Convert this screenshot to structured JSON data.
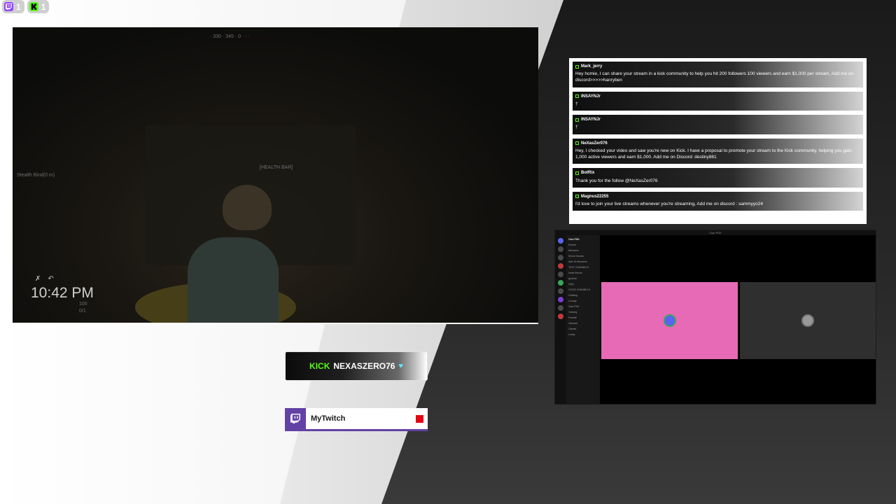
{
  "badges": [
    {
      "platform": "twitch",
      "icon": "twitch-icon",
      "count": "1",
      "color": "#9146ff"
    },
    {
      "platform": "kick",
      "icon": "kick-icon",
      "count": "1",
      "color": "#53fc18"
    }
  ],
  "game": {
    "clock": "10:42 PM",
    "hud_top": "· 330 · 345 · 0 · · ·",
    "hud_center": "[HEALTH BAR]",
    "hud_left": "Stealth Bind(0 m)",
    "hud_bottom1": "100",
    "hud_bottom2": "0/1"
  },
  "chat": {
    "messages": [
      {
        "user": "Mark_jerry",
        "text": "Hey homie, I can share your stream in a kick community to help you hit 200 followers 100 viewers and earn $1,000 per stream, Add me on discord>>>>>hanryben"
      },
      {
        "user": "INSAYNJr",
        "text": "†"
      },
      {
        "user": "INSAYNJr",
        "text": "†"
      },
      {
        "user": "NeXasZer076",
        "text": "Hey, I checked your video and saw you're new on Kick. I have a proposal to promote your stream to the Kick community, helping you gain 1,000 active viewers and earn $1,000. Add me on Discord: destiny881"
      },
      {
        "user": "BotRix",
        "text": "Thank you for the follow @NeXasZer076"
      },
      {
        "user": "Magnus22255",
        "text": "I'd love to join your live streams whenever you're streaming, Add me on discord : sammyyo24"
      }
    ]
  },
  "discord": {
    "title": "Clan PDK",
    "server_name": "Clan PDK",
    "channels": [
      "Events",
      "Members",
      "Server Boosts",
      "Add 10 Members",
      "TEXT CHANNELS",
      "Invite friends",
      "general",
      "Clips",
      "VOICE CHANNELS",
      "Chatting",
      "Lounge",
      "Clan PDK",
      "Gaming",
      "Fortnite",
      "Valorant",
      "Games",
      "Lobby"
    ],
    "tile_pink_color": "#e76ab6",
    "tile_gray_color": "#2f2f2f"
  },
  "kick_banner": {
    "brand": "KICK",
    "username": "NEXASZERO76",
    "heart_icon": "heart-icon"
  },
  "twitch_banner": {
    "label": "MyTwitch",
    "icon": "twitch-icon"
  }
}
